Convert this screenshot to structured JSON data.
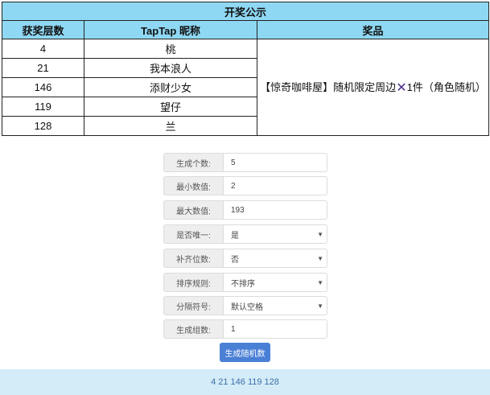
{
  "table": {
    "title": "开奖公示",
    "headers": [
      "获奖层数",
      "TapTap 昵称",
      "奖品"
    ],
    "rows": [
      {
        "floor": "4",
        "nickname": "桃"
      },
      {
        "floor": "21",
        "nickname": "我本浪人"
      },
      {
        "floor": "146",
        "nickname": "添财少女"
      },
      {
        "floor": "119",
        "nickname": "望仔"
      },
      {
        "floor": "128",
        "nickname": "兰"
      }
    ],
    "prize_prefix": "【惊奇咖啡屋】随机限定周边",
    "prize_icon": "x-mark-icon",
    "prize_suffix": "1件（角色随机）"
  },
  "form": {
    "fields": [
      {
        "label": "生成个数:",
        "value": "5",
        "type": "input"
      },
      {
        "label": "最小数值:",
        "value": "2",
        "type": "input"
      },
      {
        "label": "最大数值:",
        "value": "193",
        "type": "input"
      },
      {
        "label": "是否唯一:",
        "value": "是",
        "type": "select"
      },
      {
        "label": "补齐位数:",
        "value": "否",
        "type": "select"
      },
      {
        "label": "排序规则:",
        "value": "不排序",
        "type": "select"
      },
      {
        "label": "分隔符号:",
        "value": "默认空格",
        "type": "select"
      },
      {
        "label": "生成组数:",
        "value": "1",
        "type": "input"
      }
    ],
    "button_label": "生成随机数"
  },
  "result": "4 21 146 119 128",
  "colors": {
    "header_bg": "#8fd8f3",
    "button_bg": "#4a7fd6",
    "result_bg": "#d4ecf8",
    "x_mark": "#4b2e8a"
  }
}
